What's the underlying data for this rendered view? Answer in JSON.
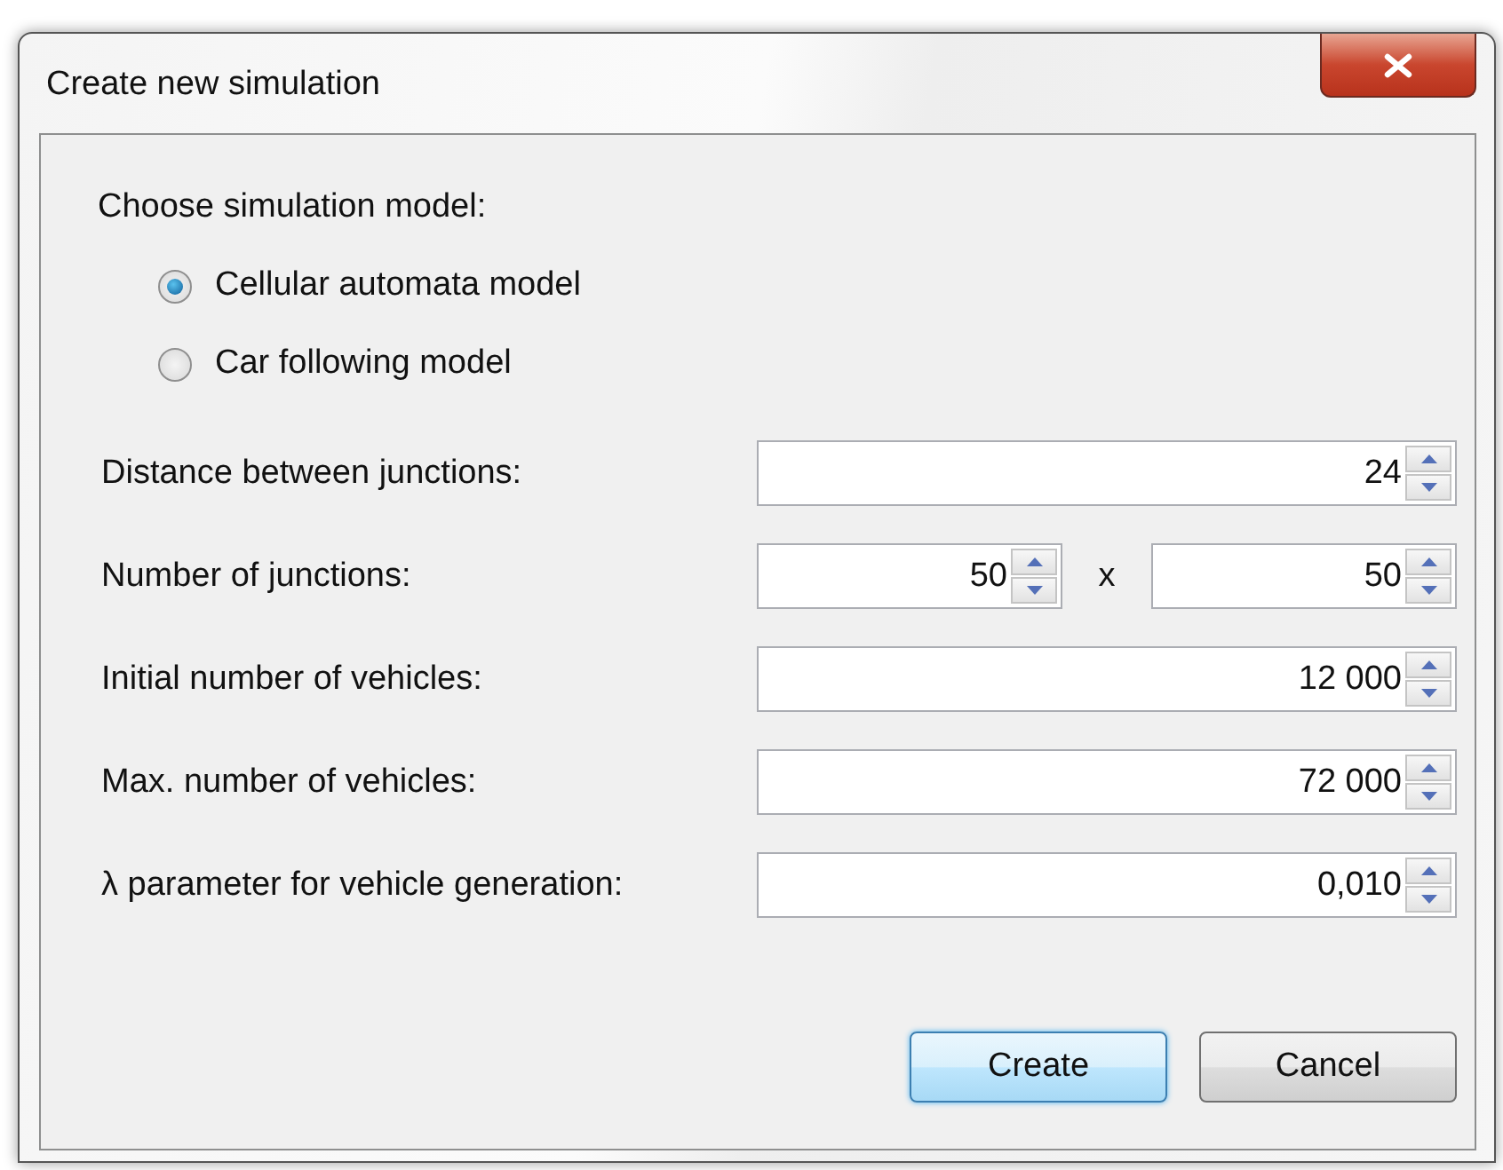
{
  "window": {
    "title": "Create new simulation"
  },
  "model_prompt": "Choose simulation model:",
  "models": [
    {
      "label": "Cellular automata model",
      "selected": true
    },
    {
      "label": "Car following model",
      "selected": false
    }
  ],
  "fields": [
    {
      "kind": "single",
      "label": "Distance between junctions:",
      "values": [
        "24"
      ]
    },
    {
      "kind": "pair",
      "label": "Number of junctions:",
      "values": [
        "50",
        "50"
      ],
      "separator": "x"
    },
    {
      "kind": "single",
      "label": "Initial number of vehicles:",
      "values": [
        "12 000"
      ]
    },
    {
      "kind": "single",
      "label": "Max. number of vehicles:",
      "values": [
        "72 000"
      ]
    },
    {
      "kind": "single",
      "label": "λ parameter for vehicle generation:",
      "values": [
        "0,010"
      ]
    }
  ],
  "buttons": [
    {
      "label": "Create",
      "default": true
    },
    {
      "label": "Cancel",
      "default": false
    }
  ]
}
